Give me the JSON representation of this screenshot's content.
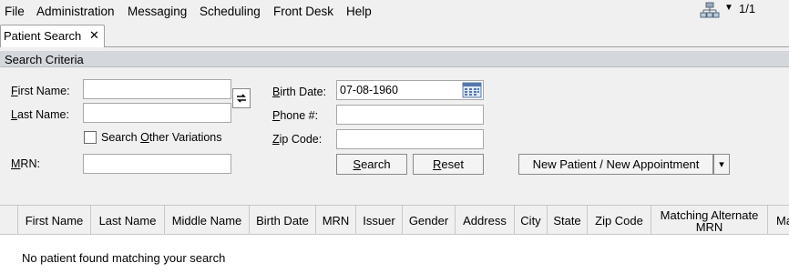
{
  "menu": {
    "file": "File",
    "administration": "Administration",
    "messaging": "Messaging",
    "scheduling": "Scheduling",
    "front_desk": "Front Desk",
    "help": "Help"
  },
  "page_indicator": "1/1",
  "tab": {
    "label": "Patient Search",
    "close": "✕"
  },
  "section_title": "Search Criteria",
  "form": {
    "first_name_label_u": "F",
    "first_name_label": "irst Name:",
    "first_name_value": "",
    "last_name_label_u": "L",
    "last_name_label": "ast Name:",
    "last_name_value": "",
    "variations_pre": "Search ",
    "variations_u": "O",
    "variations_post": "ther Variations",
    "mrn_label_u": "M",
    "mrn_label": "RN:",
    "mrn_value": "",
    "birth_date_label_u": "B",
    "birth_date_label": "irth Date:",
    "birth_date_value": "07-08-1960",
    "phone_label_u": "P",
    "phone_label": "hone #:",
    "phone_value": "",
    "zip_label_u": "Z",
    "zip_label": "ip Code:",
    "zip_value": ""
  },
  "buttons": {
    "search_u": "S",
    "search": "earch",
    "reset_u": "R",
    "reset": "eset",
    "new_patient": "New Patient / New Appointment",
    "dropdown_arrow": "▾"
  },
  "table": {
    "columns": [
      "First Name",
      "Last Name",
      "Middle Name",
      "Birth Date",
      "MRN",
      "Issuer",
      "Gender",
      "Address",
      "City",
      "State",
      "Zip Code",
      "Matching Alternate\nMRN",
      "Ma"
    ],
    "empty_message": "No patient found matching your search"
  },
  "colors": {
    "section_header": "#d4d7dc",
    "background": "#f0f0f0"
  }
}
